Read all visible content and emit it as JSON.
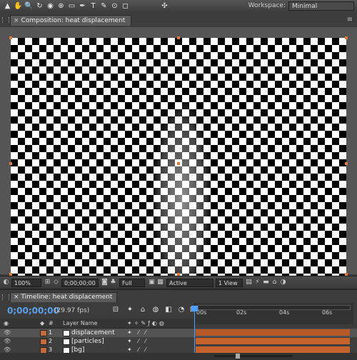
{
  "toolbar": {
    "tools": [
      "arrow-icon",
      "hand-icon",
      "zoom-icon",
      "rotate-icon",
      "unified-camera-icon",
      "pan-behind-icon",
      "mask-icon",
      "pen-icon",
      "text-icon",
      "brush-icon",
      "clone-stamp-icon",
      "eraser-icon",
      "puppet-pin-icon"
    ],
    "tool_glyphs": [
      "▲",
      "✋",
      "🔍",
      "↻",
      "◉",
      "⊕",
      "▭",
      "✒",
      "T",
      "✎",
      "⊙",
      "◻",
      "✣"
    ],
    "workspace_label": "Workspace:",
    "workspace_value": "Minimal"
  },
  "composition": {
    "tab_title": "Composition: heat displacement",
    "footer": {
      "zoom": "100%",
      "timecode": "0;00;00;00",
      "resolution": "Full",
      "camera": "Active Camera",
      "views": "1 View"
    }
  },
  "timeline": {
    "tab_title": "Timeline: heat displacement",
    "timecode": "0;00;00;00",
    "fps": "(29.97 fps)",
    "columns": {
      "num": "#",
      "layer_name": "Layer Name"
    },
    "ruler_labels": [
      "00s",
      "02s",
      "04s",
      "06s"
    ],
    "layers": [
      {
        "num": "1",
        "name": "displacement",
        "label_color": "#c96a3a",
        "selected": true
      },
      {
        "num": "2",
        "name": "[particles]",
        "label_color": "#c96a3a",
        "selected": false
      },
      {
        "num": "3",
        "name": "[bg]",
        "label_color": "#c96a3a",
        "selected": false
      }
    ]
  },
  "colors": {
    "accent": "#4ea0ff",
    "layer_bar": "#c6632d",
    "handle": "#e07b3a"
  }
}
